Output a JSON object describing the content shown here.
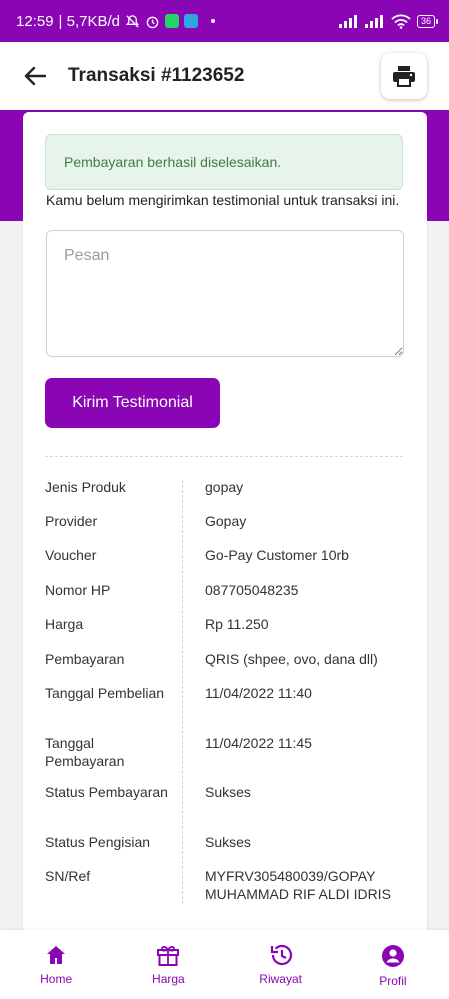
{
  "status_bar": {
    "time": "12:59",
    "network_speed": "| 5,7KB/d",
    "battery": "36"
  },
  "header": {
    "title": "Transaksi #1123652"
  },
  "alert": {
    "message": "Pembayaran berhasil diselesaikan."
  },
  "testimonial": {
    "notice": "Kamu belum mengirimkan testimonial untuk transaksi ini.",
    "placeholder": "Pesan",
    "submit_label": "Kirim Testimonial"
  },
  "details": [
    {
      "label": "Jenis Produk",
      "value": "gopay"
    },
    {
      "label": "Provider",
      "value": "Gopay"
    },
    {
      "label": "Voucher",
      "value": "Go-Pay Customer 10rb"
    },
    {
      "label": "Nomor HP",
      "value": "087705048235"
    },
    {
      "label": "Harga",
      "value": "Rp 11.250"
    },
    {
      "label": "Pembayaran",
      "value": "QRIS (shpee, ovo, dana dll)"
    },
    {
      "label": "Tanggal Pembelian",
      "value": "11/04/2022 11:40"
    },
    {
      "label": "Tanggal Pembayaran",
      "value": "11/04/2022 11:45"
    },
    {
      "label": "Status Pembayaran",
      "value": "Sukses"
    },
    {
      "label": "Status Pengisian",
      "value": "Sukses"
    },
    {
      "label": "SN/Ref",
      "value": "MYFRV305480039/GOPAY MUHAMMAD RIF ALDI IDRIS"
    }
  ],
  "bottom_nav": [
    {
      "label": "Home",
      "icon": "home-icon"
    },
    {
      "label": "Harga",
      "icon": "gift-icon"
    },
    {
      "label": "Riwayat",
      "icon": "history-icon"
    },
    {
      "label": "Profil",
      "icon": "profile-icon"
    }
  ],
  "colors": {
    "brand": "#8a06b5",
    "success_bg": "#e7f4e9",
    "success_text": "#3e7d45"
  }
}
